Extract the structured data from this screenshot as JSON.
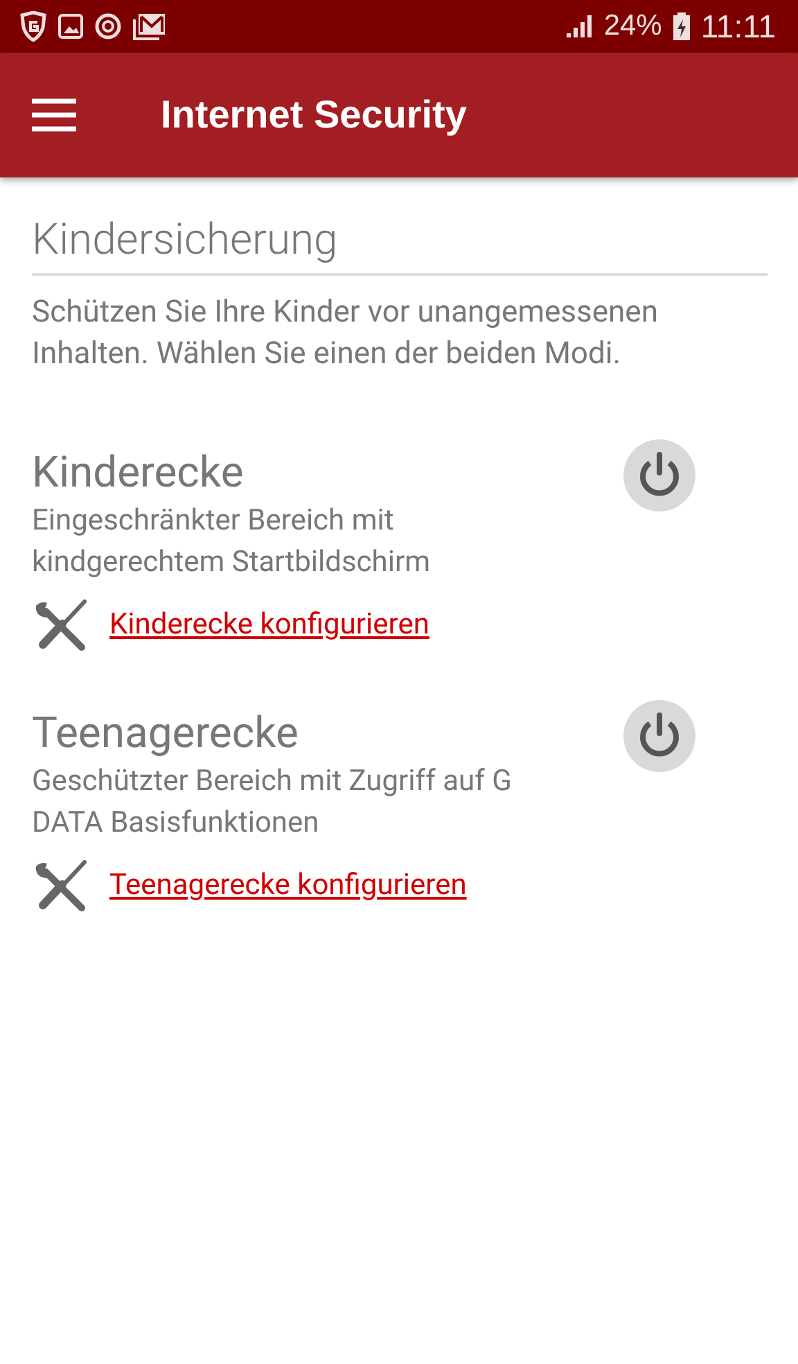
{
  "status_bar": {
    "battery": "24%",
    "time": "11:11"
  },
  "app_bar": {
    "title": "Internet Security"
  },
  "section": {
    "title": "Kindersicherung",
    "description": "Schützen Sie Ihre Kinder vor unangemessenen Inhalten. Wählen Sie einen der beiden Modi."
  },
  "modes": [
    {
      "title": "Kinderecke",
      "description": "Eingeschränkter Bereich mit kindgerechtem Startbildschirm",
      "link": "Kinderecke konfigurieren",
      "on": false
    },
    {
      "title": "Teenagerecke",
      "description": "Geschützter Bereich mit Zugriff auf G DATA Basisfunktionen",
      "link": "Teenagerecke konfigurieren",
      "on": false
    }
  ]
}
